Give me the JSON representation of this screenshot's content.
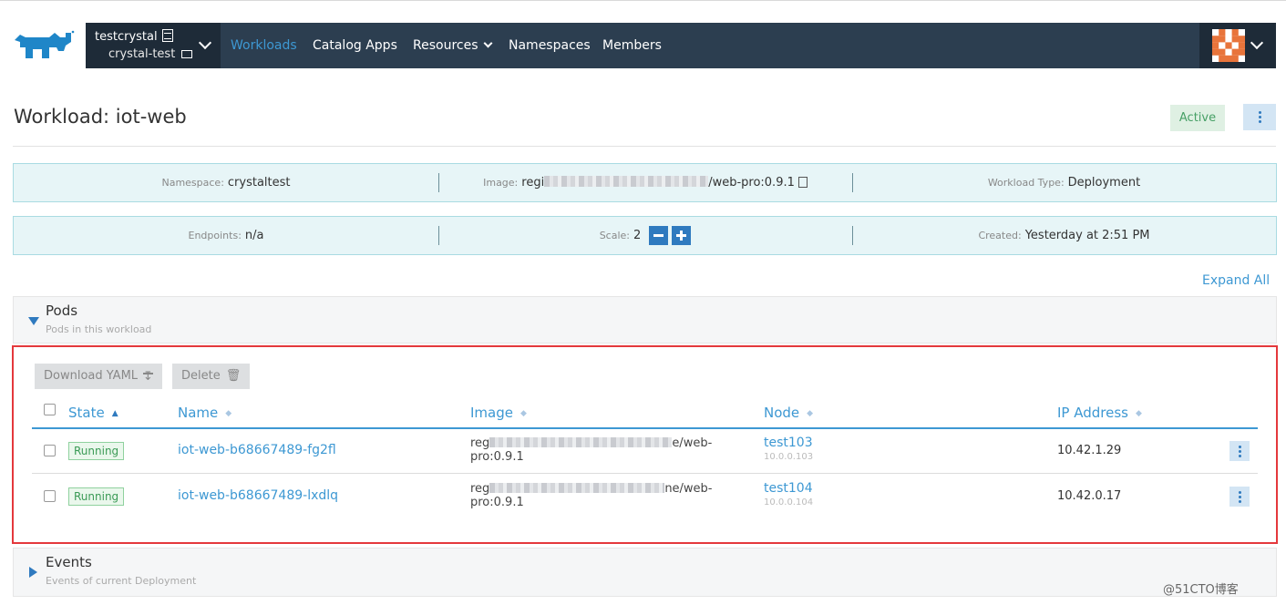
{
  "header": {
    "project": {
      "cluster": "testcrystal",
      "name": "crystal-test"
    },
    "nav": [
      {
        "label": "Workloads",
        "active": true
      },
      {
        "label": "Catalog Apps"
      },
      {
        "label": "Resources"
      },
      {
        "label": "Namespaces"
      },
      {
        "label": "Members"
      }
    ]
  },
  "page": {
    "title": "Workload: iot-web",
    "status": "Active"
  },
  "info": {
    "namespace_label": "Namespace:",
    "namespace": "crystaltest",
    "image_label": "Image:",
    "image_prefix": "regi",
    "image_suffix": "/web-pro:0.9.1",
    "workload_type_label": "Workload Type:",
    "workload_type": "Deployment",
    "endpoints_label": "Endpoints:",
    "endpoints": "n/a",
    "scale_label": "Scale:",
    "scale": "2",
    "created_label": "Created:",
    "created": "Yesterday at 2:51 PM"
  },
  "expand_all": "Expand All",
  "pods_section": {
    "title": "Pods",
    "subtitle": "Pods in this workload",
    "toolbar": {
      "download": "Download YAML",
      "delete": "Delete"
    },
    "columns": [
      "State",
      "Name",
      "Image",
      "Node",
      "IP Address"
    ],
    "rows": [
      {
        "state": "Running",
        "name": "iot-web-b68667489-fg2fl",
        "image_start": "reg",
        "image_end": "e/web-",
        "image_line2": "pro:0.9.1",
        "node": "test103",
        "node_ip": "10.0.0.103",
        "ip": "10.42.1.29"
      },
      {
        "state": "Running",
        "name": "iot-web-b68667489-lxdlq",
        "image_start": "reg",
        "image_end": "ne/web-",
        "image_line2": "pro:0.9.1",
        "node": "test104",
        "node_ip": "10.0.0.104",
        "ip": "10.42.0.17"
      }
    ]
  },
  "events_section": {
    "title": "Events",
    "subtitle": "Events of current Deployment"
  },
  "watermark": "@51CTO博客",
  "colors": {
    "nav_bg": "#2c3e50",
    "accent": "#3d98d3",
    "highlight_border": "#e4383c",
    "success": "#47a066"
  }
}
